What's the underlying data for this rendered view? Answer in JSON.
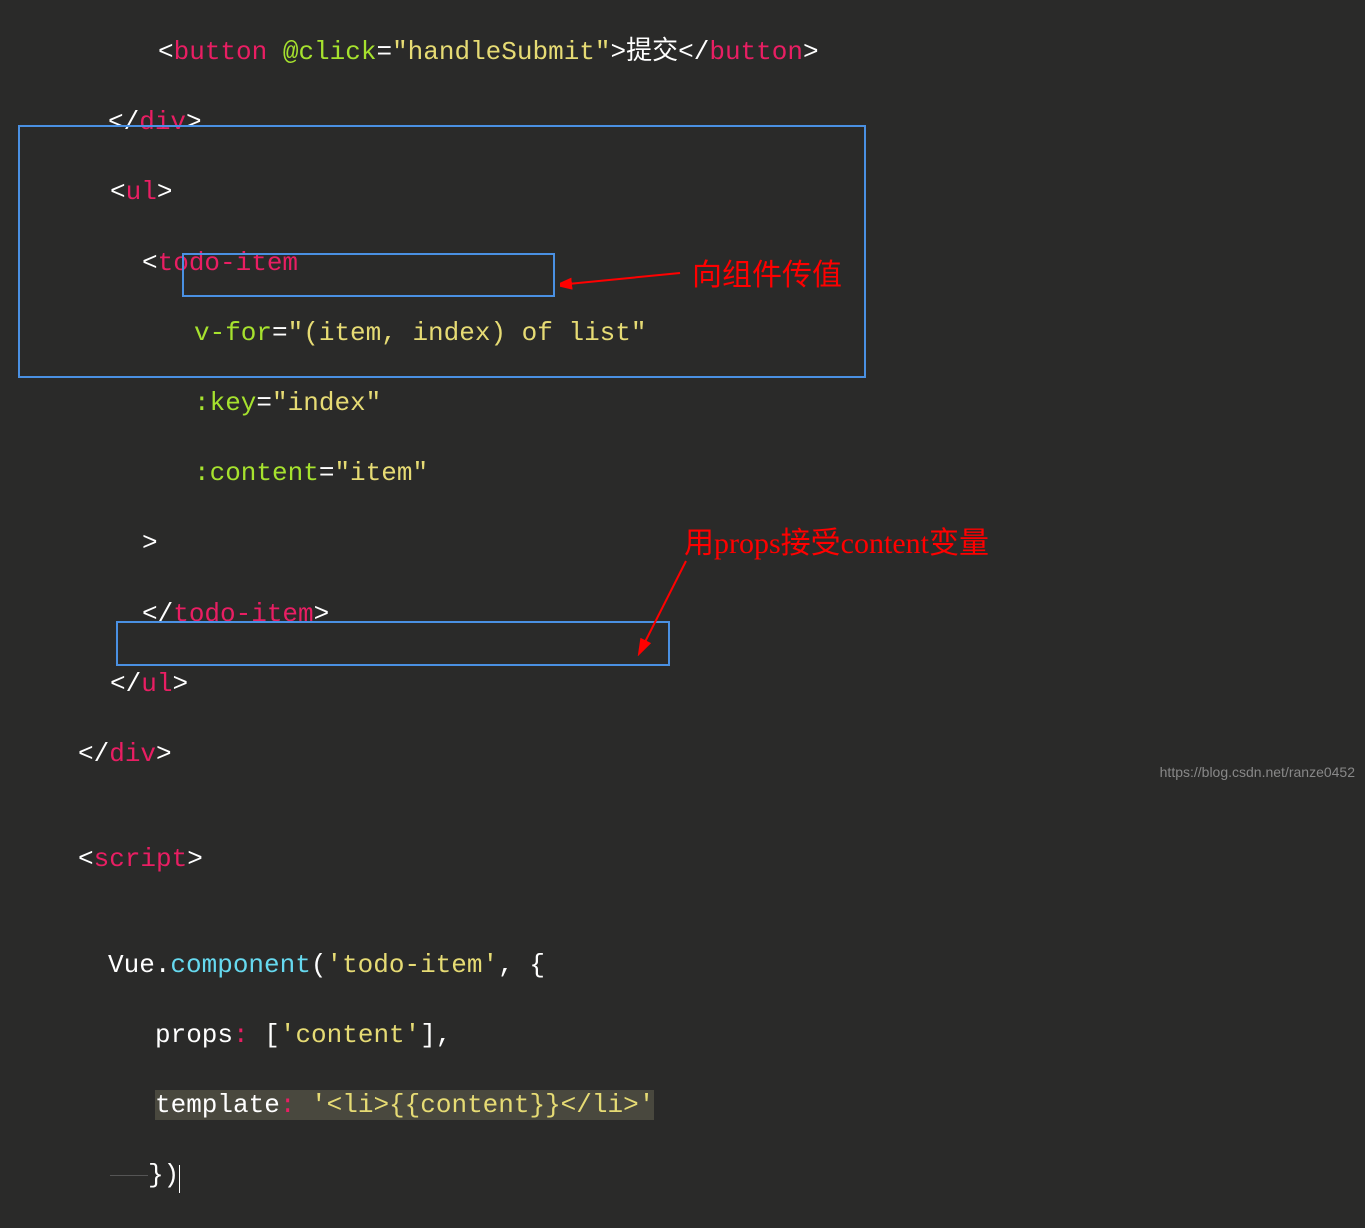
{
  "code": {
    "line1a": "<",
    "line1_tag": "button",
    "line1_attr": " @click",
    "line1_eq": "=",
    "line1_str": "\"handleSubmit\"",
    "line1_gt": ">",
    "line1_text": "提交",
    "line1_close1": "</",
    "line1_close2": ">",
    "line2_open": "</",
    "line2_tag": "div",
    "line2_close": ">",
    "line3_open": "<",
    "line3_tag": "ul",
    "line3_close": ">",
    "line4_open": "<",
    "line4_tag": "todo-item",
    "line5_attr": "v-for",
    "line5_eq": "=",
    "line5_str": "\"(item, index) of list\"",
    "line6_attr": ":key",
    "line6_eq": "=",
    "line6_str": "\"index\"",
    "line7_attr": ":content",
    "line7_eq": "=",
    "line7_str": "\"item\"",
    "line8_close": ">",
    "line9_open": "</",
    "line9_tag": "todo-item",
    "line9_close": ">",
    "line10_open": "</",
    "line10_tag": "ul",
    "line10_close": ">",
    "line11_open": "</",
    "line11_tag": "div",
    "line11_close": ">",
    "line12_open": "<",
    "line12_tag": "script",
    "line12_close": ">",
    "line13_vue": "Vue",
    "line13_dot": ".",
    "line13_comp": "component",
    "line13_paren1": "(",
    "line13_str": "'todo-item'",
    "line13_comma": ",",
    "line13_brace": " {",
    "line14_props": "props",
    "line14_colon": ":",
    "line14_arr": " [",
    "line14_str": "'content'",
    "line14_arr2": "]",
    "line14_comma": ",",
    "line15_tmpl": "template",
    "line15_colon": ":",
    "line15_str": " '<li>{{content}}</li>'",
    "line16_close": "})"
  },
  "annotations": {
    "anno1": "向组件传值",
    "anno2": "用props接受content变量"
  },
  "watermark": "https://blog.csdn.net/ranze0452"
}
